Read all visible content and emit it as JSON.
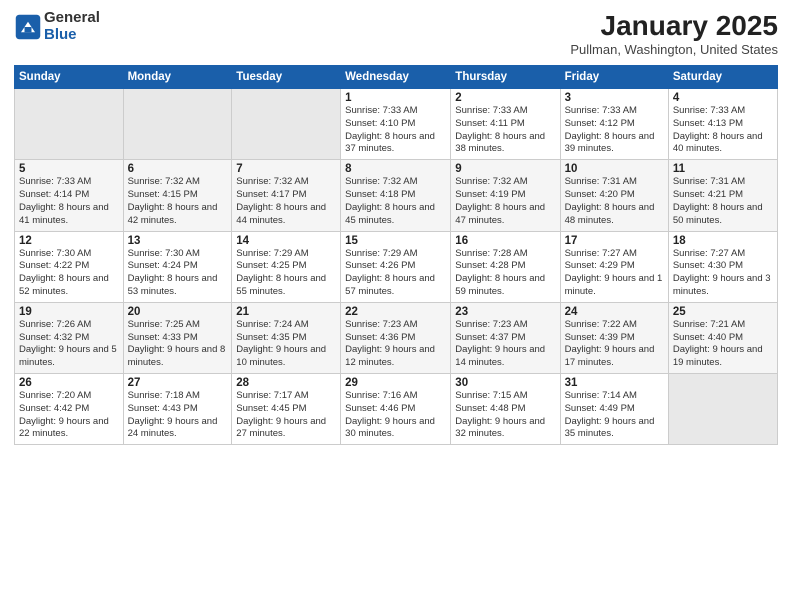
{
  "header": {
    "logo": {
      "general": "General",
      "blue": "Blue"
    },
    "title": "January 2025",
    "location": "Pullman, Washington, United States"
  },
  "days_of_week": [
    "Sunday",
    "Monday",
    "Tuesday",
    "Wednesday",
    "Thursday",
    "Friday",
    "Saturday"
  ],
  "weeks": [
    [
      {
        "day": "",
        "info": ""
      },
      {
        "day": "",
        "info": ""
      },
      {
        "day": "",
        "info": ""
      },
      {
        "day": "1",
        "info": "Sunrise: 7:33 AM\nSunset: 4:10 PM\nDaylight: 8 hours and 37 minutes."
      },
      {
        "day": "2",
        "info": "Sunrise: 7:33 AM\nSunset: 4:11 PM\nDaylight: 8 hours and 38 minutes."
      },
      {
        "day": "3",
        "info": "Sunrise: 7:33 AM\nSunset: 4:12 PM\nDaylight: 8 hours and 39 minutes."
      },
      {
        "day": "4",
        "info": "Sunrise: 7:33 AM\nSunset: 4:13 PM\nDaylight: 8 hours and 40 minutes."
      }
    ],
    [
      {
        "day": "5",
        "info": "Sunrise: 7:33 AM\nSunset: 4:14 PM\nDaylight: 8 hours and 41 minutes."
      },
      {
        "day": "6",
        "info": "Sunrise: 7:32 AM\nSunset: 4:15 PM\nDaylight: 8 hours and 42 minutes."
      },
      {
        "day": "7",
        "info": "Sunrise: 7:32 AM\nSunset: 4:17 PM\nDaylight: 8 hours and 44 minutes."
      },
      {
        "day": "8",
        "info": "Sunrise: 7:32 AM\nSunset: 4:18 PM\nDaylight: 8 hours and 45 minutes."
      },
      {
        "day": "9",
        "info": "Sunrise: 7:32 AM\nSunset: 4:19 PM\nDaylight: 8 hours and 47 minutes."
      },
      {
        "day": "10",
        "info": "Sunrise: 7:31 AM\nSunset: 4:20 PM\nDaylight: 8 hours and 48 minutes."
      },
      {
        "day": "11",
        "info": "Sunrise: 7:31 AM\nSunset: 4:21 PM\nDaylight: 8 hours and 50 minutes."
      }
    ],
    [
      {
        "day": "12",
        "info": "Sunrise: 7:30 AM\nSunset: 4:22 PM\nDaylight: 8 hours and 52 minutes."
      },
      {
        "day": "13",
        "info": "Sunrise: 7:30 AM\nSunset: 4:24 PM\nDaylight: 8 hours and 53 minutes."
      },
      {
        "day": "14",
        "info": "Sunrise: 7:29 AM\nSunset: 4:25 PM\nDaylight: 8 hours and 55 minutes."
      },
      {
        "day": "15",
        "info": "Sunrise: 7:29 AM\nSunset: 4:26 PM\nDaylight: 8 hours and 57 minutes."
      },
      {
        "day": "16",
        "info": "Sunrise: 7:28 AM\nSunset: 4:28 PM\nDaylight: 8 hours and 59 minutes."
      },
      {
        "day": "17",
        "info": "Sunrise: 7:27 AM\nSunset: 4:29 PM\nDaylight: 9 hours and 1 minute."
      },
      {
        "day": "18",
        "info": "Sunrise: 7:27 AM\nSunset: 4:30 PM\nDaylight: 9 hours and 3 minutes."
      }
    ],
    [
      {
        "day": "19",
        "info": "Sunrise: 7:26 AM\nSunset: 4:32 PM\nDaylight: 9 hours and 5 minutes."
      },
      {
        "day": "20",
        "info": "Sunrise: 7:25 AM\nSunset: 4:33 PM\nDaylight: 9 hours and 8 minutes."
      },
      {
        "day": "21",
        "info": "Sunrise: 7:24 AM\nSunset: 4:35 PM\nDaylight: 9 hours and 10 minutes."
      },
      {
        "day": "22",
        "info": "Sunrise: 7:23 AM\nSunset: 4:36 PM\nDaylight: 9 hours and 12 minutes."
      },
      {
        "day": "23",
        "info": "Sunrise: 7:23 AM\nSunset: 4:37 PM\nDaylight: 9 hours and 14 minutes."
      },
      {
        "day": "24",
        "info": "Sunrise: 7:22 AM\nSunset: 4:39 PM\nDaylight: 9 hours and 17 minutes."
      },
      {
        "day": "25",
        "info": "Sunrise: 7:21 AM\nSunset: 4:40 PM\nDaylight: 9 hours and 19 minutes."
      }
    ],
    [
      {
        "day": "26",
        "info": "Sunrise: 7:20 AM\nSunset: 4:42 PM\nDaylight: 9 hours and 22 minutes."
      },
      {
        "day": "27",
        "info": "Sunrise: 7:18 AM\nSunset: 4:43 PM\nDaylight: 9 hours and 24 minutes."
      },
      {
        "day": "28",
        "info": "Sunrise: 7:17 AM\nSunset: 4:45 PM\nDaylight: 9 hours and 27 minutes."
      },
      {
        "day": "29",
        "info": "Sunrise: 7:16 AM\nSunset: 4:46 PM\nDaylight: 9 hours and 30 minutes."
      },
      {
        "day": "30",
        "info": "Sunrise: 7:15 AM\nSunset: 4:48 PM\nDaylight: 9 hours and 32 minutes."
      },
      {
        "day": "31",
        "info": "Sunrise: 7:14 AM\nSunset: 4:49 PM\nDaylight: 9 hours and 35 minutes."
      },
      {
        "day": "",
        "info": ""
      }
    ]
  ]
}
